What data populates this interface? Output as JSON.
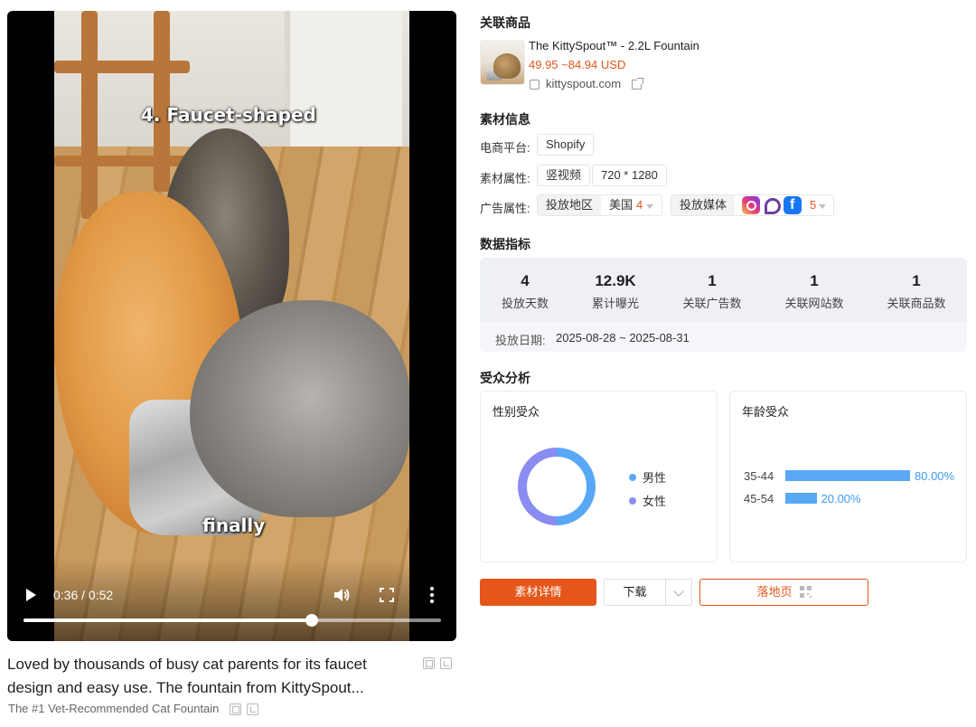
{
  "video": {
    "caption_top": "4. Faucet-shaped",
    "caption_bottom": "finally",
    "current_time": "0:36",
    "duration": "0:52",
    "time_display": "0:36 / 0:52",
    "progress_fraction": 0.69
  },
  "description": {
    "text": "Loved by thousands of busy cat parents for its faucet design and easy use. The fountain from KittySpout...",
    "subtitle": "The #1 Vet-Recommended Cat Fountain"
  },
  "product": {
    "section_title": "关联商品",
    "name": "The KittySpout™ - 2.2L Fountain",
    "price": "49.95 ~84.94 USD",
    "domain": "kittyspout.com"
  },
  "material": {
    "section_title": "素材信息",
    "platform_label": "电商平台:",
    "platform": "Shopify",
    "attr_label": "素材属性:",
    "format": "竖视频",
    "resolution": "720 * 1280",
    "ad_label": "广告属性:",
    "region_label": "投放地区",
    "region": "美国",
    "region_count": "4",
    "media_label": "投放媒体",
    "media_icons": [
      "instagram-icon",
      "messenger-icon",
      "facebook-icon"
    ],
    "media_count": "5"
  },
  "metrics": {
    "section_title": "数据指标",
    "items": [
      {
        "value": "4",
        "label": "投放天数"
      },
      {
        "value": "12.9K",
        "label": "累计曝光"
      },
      {
        "value": "1",
        "label": "关联广告数"
      },
      {
        "value": "1",
        "label": "关联网站数"
      },
      {
        "value": "1",
        "label": "关联商品数"
      }
    ],
    "date_label": "投放日期:",
    "date_range": "2025-08-28 ~ 2025-08-31"
  },
  "audience": {
    "section_title": "受众分析",
    "gender_title": "性别受众",
    "gender_legend": [
      "男性",
      "女性"
    ],
    "gender_colors": [
      "#59a8f5",
      "#8a8cf2"
    ],
    "gender_share": {
      "male": 0.5,
      "female": 0.5
    },
    "age_title": "年龄受众",
    "age_rows": [
      {
        "label": "35-44",
        "pct": "80.00%",
        "value": 0.8
      },
      {
        "label": "45-54",
        "pct": "20.00%",
        "value": 0.2
      }
    ]
  },
  "actions": {
    "detail": "素材详情",
    "download": "下载",
    "landing": "落地页"
  },
  "colors": {
    "accent": "#e4561a",
    "bar": "#59a8f5"
  }
}
